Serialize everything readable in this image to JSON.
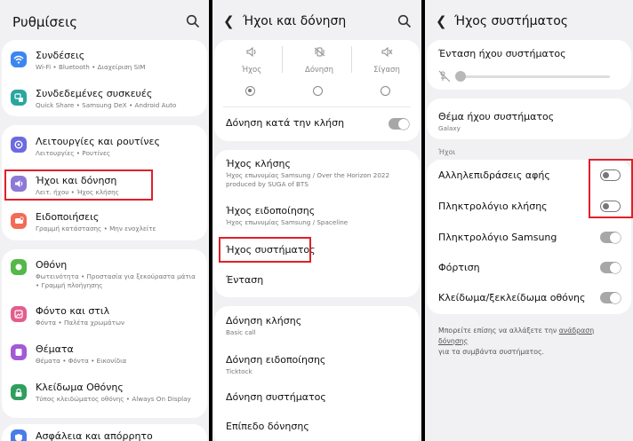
{
  "settings": {
    "title": "Ρυθμίσεις",
    "items": [
      {
        "title": "Συνδέσεις",
        "sub": "Wi-Fi  •  Bluetooth  •  Διαχείριση SIM",
        "icon": "wifi-icon",
        "color": "#3d86f0"
      },
      {
        "title": "Συνδεδεμένες συσκευές",
        "sub": "Quick Share  •  Samsung DeX  •  Android Auto",
        "icon": "connected-devices-icon",
        "color": "#2aa6a0"
      },
      {
        "title": "Λειτουργίες και ρουτίνες",
        "sub": "Λειτουργίες  •  Ρουτίνες",
        "icon": "modes-routines-icon",
        "color": "#6c6ae0"
      },
      {
        "title": "Ήχοι και δόνηση",
        "sub": "Λειτ. ήχου  •  Ήχος κλήσης",
        "icon": "sound-icon",
        "color": "#8e79d6"
      },
      {
        "title": "Ειδοποιήσεις",
        "sub": "Γραμμή κατάστασης  •  Μην ενοχλείτε",
        "icon": "notifications-icon",
        "color": "#f26b57"
      },
      {
        "title": "Οθόνη",
        "sub": "Φωτεινότητα  •  Προστασία για ξεκούραστα μάτια",
        "sub2": "•  Γραμμή πλοήγησης",
        "icon": "display-icon",
        "color": "#55b84a"
      },
      {
        "title": "Φόντο και στιλ",
        "sub": "Φόντα  •  Παλέτα χρωμάτων",
        "icon": "wallpaper-icon",
        "color": "#e35d8c"
      },
      {
        "title": "Θέματα",
        "sub": "Θέματα  •  Φόντα  •  Εικονίδια",
        "icon": "themes-icon",
        "color": "#a35ad6"
      },
      {
        "title": "Κλείδωμα Οθόνης",
        "sub": "Τύπος κλειδώματος οθόνης  •  Always On Display",
        "icon": "lock-screen-icon",
        "color": "#2f9e5e"
      },
      {
        "title": "Ασφάλεια και απόρρητο",
        "sub": "",
        "icon": "security-icon",
        "color": "#4a7ce8"
      }
    ]
  },
  "sounds": {
    "title": "Ήχοι και δόνηση",
    "modes": [
      {
        "label": "Ήχος",
        "icon": "speaker-icon",
        "selected": true
      },
      {
        "label": "Δόνηση",
        "icon": "vibrate-icon",
        "selected": false
      },
      {
        "label": "Σίγαση",
        "icon": "mute-icon",
        "selected": false
      }
    ],
    "vibrate_while_ringing": "Δόνηση κατά την κλήση",
    "ringtone": {
      "title": "Ήχος κλήσης",
      "sub1": "Ήχος επωνυμίας Samsung / Over the Horizon 2022",
      "sub2": "produced by SUGA of BTS"
    },
    "notification_sound": {
      "title": "Ήχος ειδοποίησης",
      "sub": "Ήχος επωνυμίας Samsung / Spaceline"
    },
    "system_sound": "Ήχος συστήματος",
    "volume": "Ένταση",
    "call_vibration": {
      "title": "Δόνηση κλήσης",
      "sub": "Basic call"
    },
    "notification_vibration": {
      "title": "Δόνηση ειδοποίησης",
      "sub": "Ticktock"
    },
    "system_vibration": "Δόνηση συστήματος",
    "vibration_level": "Επίπεδο δόνησης"
  },
  "system_sound": {
    "title": "Ήχος συστήματος",
    "volume_label": "Ένταση ήχου συστήματος",
    "volume_level": 0,
    "theme_title": "Θέμα ήχου συστήματος",
    "theme_value": "Galaxy",
    "section": "Ήχοι",
    "toggles": [
      {
        "label": "Αλληλεπιδράσεις αφής",
        "on": false
      },
      {
        "label": "Πληκτρολόγιο κλήσης",
        "on": false
      },
      {
        "label": "Πληκτρολόγιο Samsung",
        "on": true
      },
      {
        "label": "Φόρτιση",
        "on": true
      },
      {
        "label": "Κλείδωμα/ξεκλείδωμα οθόνης",
        "on": true
      }
    ],
    "footer_pre": "Μπορείτε επίσης να αλλάξετε την ",
    "footer_link": "ανάδραση δόνησης",
    "footer_post": "για τα συμβάντα συστήματος."
  }
}
